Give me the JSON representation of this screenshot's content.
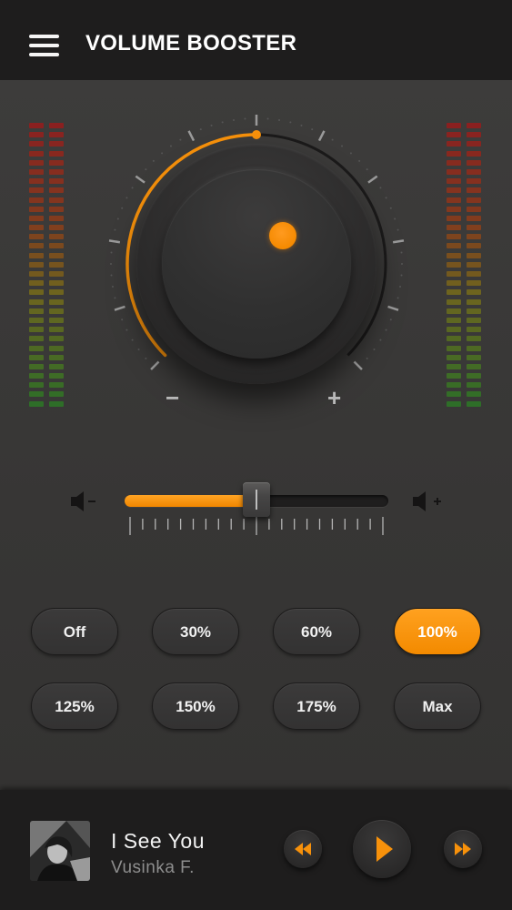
{
  "header": {
    "title": "VOLUME BOOSTER"
  },
  "knob": {
    "minus_label": "−",
    "plus_label": "+",
    "level_fraction": 0.5
  },
  "slider": {
    "level_fraction": 0.5
  },
  "presets": [
    {
      "label": "Off",
      "active": false
    },
    {
      "label": "30%",
      "active": false
    },
    {
      "label": "60%",
      "active": false
    },
    {
      "label": "100%",
      "active": true
    },
    {
      "label": "125%",
      "active": false
    },
    {
      "label": "150%",
      "active": false
    },
    {
      "label": "175%",
      "active": false
    },
    {
      "label": "Max",
      "active": false
    }
  ],
  "player": {
    "track_title": "I See You",
    "artist": "Vusinka F."
  },
  "colors": {
    "accent": "#f7910b",
    "background": "#3a3938",
    "bar": "#1e1d1d"
  }
}
